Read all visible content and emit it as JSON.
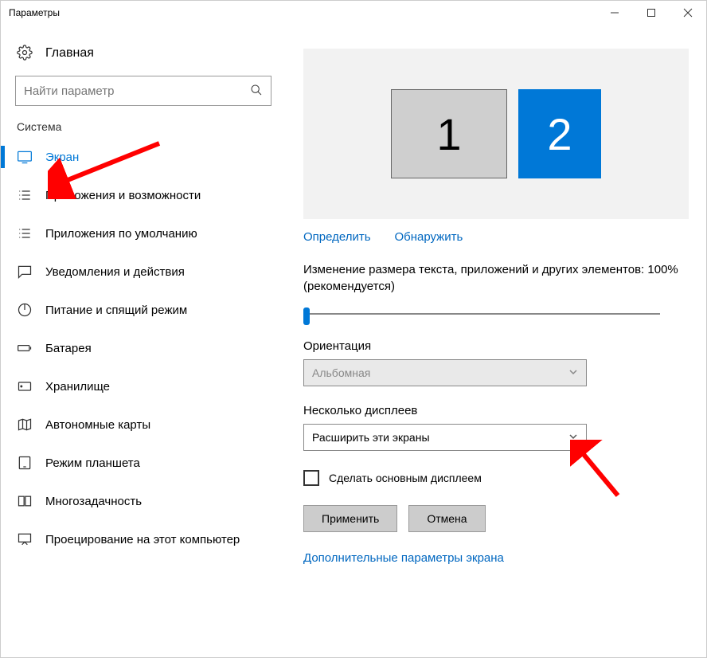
{
  "window": {
    "title": "Параметры"
  },
  "home": {
    "label": "Главная"
  },
  "search": {
    "placeholder": "Найти параметр"
  },
  "section": {
    "title": "Система"
  },
  "nav": {
    "items": [
      {
        "label": "Экран"
      },
      {
        "label": "Приложения и возможности"
      },
      {
        "label": "Приложения по умолчанию"
      },
      {
        "label": "Уведомления и действия"
      },
      {
        "label": "Питание и спящий режим"
      },
      {
        "label": "Батарея"
      },
      {
        "label": "Хранилище"
      },
      {
        "label": "Автономные карты"
      },
      {
        "label": "Режим планшета"
      },
      {
        "label": "Многозадачность"
      },
      {
        "label": "Проецирование на этот компьютер"
      }
    ]
  },
  "display": {
    "monitor1": "1",
    "monitor2": "2",
    "identify": "Определить",
    "detect": "Обнаружить",
    "scale_text": "Изменение размера текста, приложений и других элементов: 100% (рекомендуется)",
    "orientation_label": "Ориентация",
    "orientation_value": "Альбомная",
    "multi_label": "Несколько дисплеев",
    "multi_value": "Расширить эти экраны",
    "make_main": "Сделать основным дисплеем",
    "apply": "Применить",
    "cancel": "Отмена",
    "advanced": "Дополнительные параметры экрана"
  }
}
